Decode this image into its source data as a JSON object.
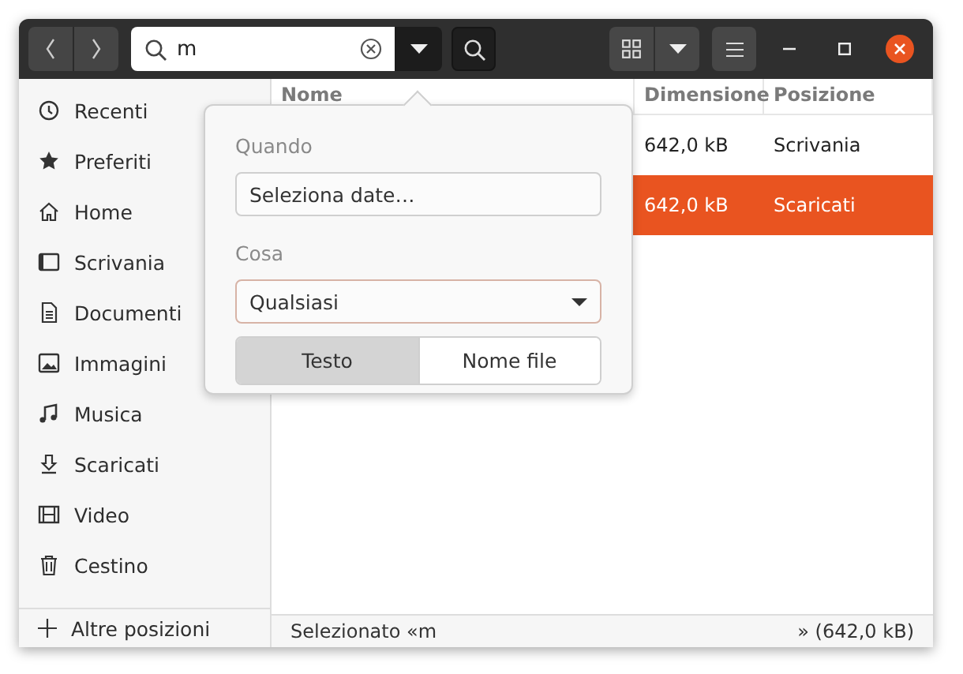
{
  "search": {
    "value": "m"
  },
  "sidebar": {
    "items": [
      {
        "label": "Recenti",
        "kind": "recent",
        "selected": false
      },
      {
        "label": "Preferiti",
        "kind": "star",
        "selected": false
      },
      {
        "label": "Home",
        "kind": "home",
        "selected": false
      },
      {
        "label": "Scrivania",
        "kind": "desktop",
        "selected": false
      },
      {
        "label": "Documenti",
        "kind": "document",
        "selected": false
      },
      {
        "label": "Immagini",
        "kind": "image",
        "selected": false
      },
      {
        "label": "Musica",
        "kind": "music",
        "selected": false
      },
      {
        "label": "Scaricati",
        "kind": "download",
        "selected": false
      },
      {
        "label": "Video",
        "kind": "video",
        "selected": false
      },
      {
        "label": "Cestino",
        "kind": "trash",
        "selected": false
      }
    ],
    "other": {
      "label": "Altre posizioni"
    }
  },
  "table": {
    "columns": [
      "Nome",
      "Dimensione",
      "Posizione"
    ],
    "rows": [
      {
        "size": "642,0 kB",
        "location": "Scrivania",
        "selected": false
      },
      {
        "size": "642,0 kB",
        "location": "Scaricati",
        "selected": true
      }
    ]
  },
  "search_popover": {
    "when_label": "Quando",
    "date_button": "Seleziona date…",
    "what_label": "Cosa",
    "type_dropdown": "Qualsiasi",
    "modes": [
      {
        "label": "Testo",
        "selected": true
      },
      {
        "label": "Nome file",
        "selected": false
      }
    ]
  },
  "status_bar": {
    "left": "Selezionato «m",
    "right": "» (642,0 kB)"
  }
}
